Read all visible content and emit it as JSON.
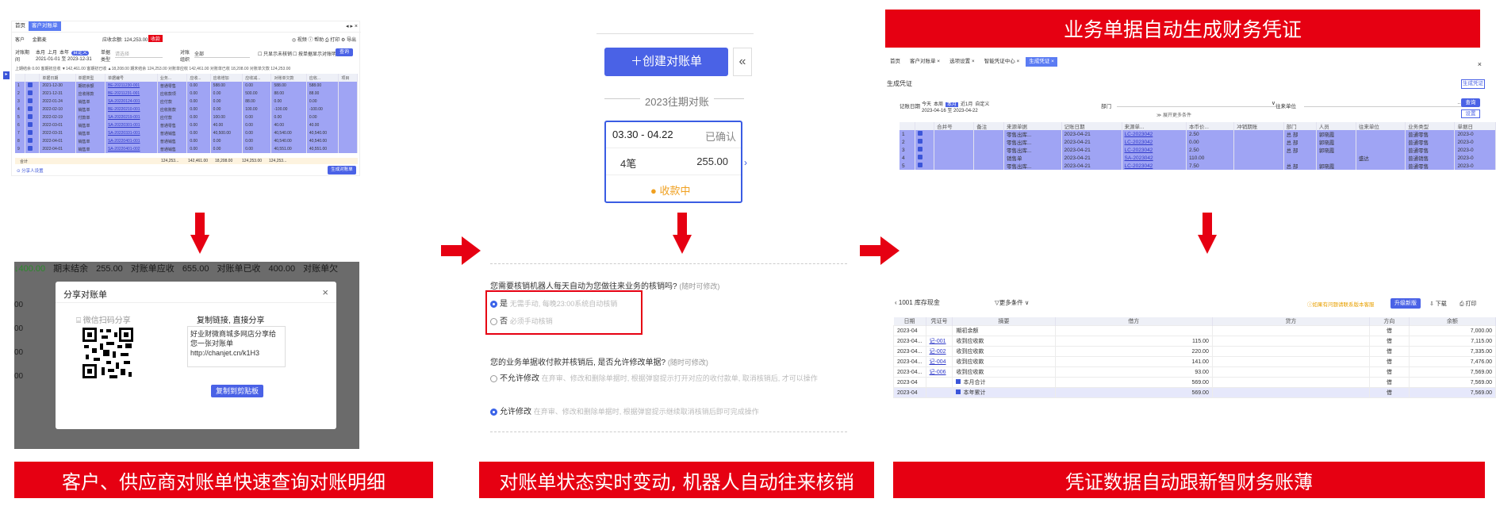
{
  "panel1": {
    "tabs": [
      "首页",
      "客户对账单"
    ],
    "top_right": "◂ ▸ ×",
    "customer_label": "客户",
    "customer_value": "金鹏麦",
    "balance_label": "应收余额: 124,253.00",
    "balance_tag": "收款",
    "actions": "◎ 视频  ⓘ 帮助  ⎙ 打印 ⚙ 导出",
    "period_label": "对账期间",
    "period_opts": [
      "本月",
      "上月",
      "本年",
      "自定义"
    ],
    "period_range": "2021-01-01 至 2023-12-31",
    "doc_type_label": "单据类型",
    "doc_type_value": "请选择",
    "org_label": "对账组织",
    "org_value": "全部",
    "option1": "只显示未核销",
    "option2": "按单据显示对账明细",
    "query_btn": "查询",
    "summary": "上期结余 0.00   客期初应收 ▼142,461.00   客期初已收 ▲18,208.00   期末结余 124,253.00   对账单应收 142,461.00   对账单已收 18,208.00   对账单欠款 124,253.00",
    "columns": [
      "",
      "",
      "单据日期",
      "单据类型",
      "单据编号",
      "业务...",
      "应收...",
      "应收增加",
      "应收减...",
      "对账单欠款",
      "应收...",
      "项目"
    ],
    "rows": [
      [
        "1",
        "2021-12-30",
        "期初余额",
        "BE-20211230-001",
        "普通零售",
        "0.00",
        "588.00",
        "0.00",
        "588.00",
        "588.00"
      ],
      [
        "2",
        "2021-12-31",
        "应收账款",
        "BE-20211231-001",
        "应收款项",
        "0.00",
        "0.00",
        "500.00",
        "88.00",
        "88.00"
      ],
      [
        "3",
        "2022-01-24",
        "销售单",
        "SA-20220124-001",
        "应付款",
        "0.00",
        "0.00",
        "88.00",
        "0.00",
        "0.00"
      ],
      [
        "4",
        "2022-02-10",
        "销售单",
        "BE-20220210-001",
        "应收账款",
        "0.00",
        "0.00",
        "100.00",
        "-100.00",
        "-100.00"
      ],
      [
        "5",
        "2022-02-19",
        "付款单",
        "SA-20220219-001",
        "应付款",
        "0.00",
        "100.00",
        "0.00",
        "0.00",
        "0.00"
      ],
      [
        "6",
        "2022-03-01",
        "销售单",
        "SA-20220301-001",
        "普通零售",
        "0.00",
        "40.00",
        "0.00",
        "40.00",
        "40.00"
      ],
      [
        "7",
        "2022-03-31",
        "销售单",
        "SA-20220331-001",
        "普通销售",
        "0.00",
        "40,500.00",
        "0.00",
        "40,540.00",
        "40,540.00"
      ],
      [
        "8",
        "2022-04-01",
        "销售单",
        "SA-20220401-001",
        "普通销售",
        "0.00",
        "0.00",
        "0.00",
        "40,540.00",
        "40,540.00"
      ],
      [
        "9",
        "2022-04-01",
        "销售单",
        "SA-20220401-002",
        "普通销售",
        "0.00",
        "0.00",
        "0.00",
        "40,551.00",
        "40,551.00"
      ]
    ],
    "total_row": [
      "合计",
      "124,253...",
      "142,461.00",
      "18,208.00",
      "124,253.00",
      "124,253..."
    ],
    "share_people": "⊙ 分享人设置",
    "gen_btn": "生成对账单"
  },
  "panel2": {
    "bg_row": [
      "↓400.00",
      "期末结余",
      "255.00",
      "对账单应收",
      "655.00",
      "对账单已收",
      "400.00",
      "对账单欠"
    ],
    "bg_left": [
      "00",
      "00",
      "00",
      "00"
    ],
    "dialog_title": "分享对账单",
    "close": "×",
    "wechat_label": "⌸ 微信扫码分享",
    "copy_title": "复制链接, 直接分享",
    "share_text": "好业财微商城多网店分享给您一张对账单",
    "share_link": "http://chanjet.cn/k1H3",
    "copy_btn": "复制到剪贴板"
  },
  "panel3": {
    "create_btn": "＋创建对账单",
    "collapse": "«",
    "year_label": "2023往期对账",
    "card_range": "03.30 - 04.22",
    "card_status": "已确认",
    "card_count": "4笔",
    "card_amount": "255.00",
    "card_receive": "收款中",
    "q1": "您需要核销机器人每天自动为您做往来业务的核销吗?",
    "q1_note": "(随时可修改)",
    "q1_opt1": "是",
    "q1_opt1_desc": "无需手动, 每晚23:00系统自动核销",
    "q1_opt2": "否",
    "q1_opt2_desc": "必须手动核销",
    "q2": "您的业务单据收付款并核销后, 是否允许修改单据?",
    "q2_note": "(随时可修改)",
    "q2_opt1": "不允许修改",
    "q2_opt1_desc": "在弃审、修改和删除单据时, 根据弹窗提示打开对应的收付款单, 取消核销后, 才可以操作",
    "q2_opt2": "允许修改",
    "q2_opt2_desc": "在弃审、修改和删除单据时, 根据弹窗提示继续取消核销后即可完成操作"
  },
  "panel4": {
    "tabs": [
      "首页",
      "客户对账单 ×",
      "选项设置 ×",
      "智能凭证中心 ×",
      "生成凭证 ×"
    ],
    "close": "×",
    "title": "生成凭证",
    "gen_btn": "生成凭证",
    "date_label": "记账日期",
    "date_opts": [
      "今天",
      "本周",
      "本月",
      "近1月",
      "自定义"
    ],
    "date_range": "2023-04-16 至 2023-04-22",
    "dept_label": "部门",
    "partner_label": "往来单位",
    "more": "≫ 展开更多条件",
    "query_btn": "查询",
    "settings_btn": "设置",
    "columns": [
      "",
      "",
      "合并号",
      "备注",
      "来源单据",
      "记账日期",
      "来源单...",
      "本币价...",
      "冲销期账",
      "部门",
      "人员",
      "往来单位",
      "业务类型",
      "单据日"
    ],
    "rows": [
      [
        "1",
        "",
        "",
        "零售出库...",
        "2023-04-21",
        "LC-2023042",
        "2.50",
        "",
        "总 部",
        "郭晓霞",
        "",
        "普通零售",
        "2023-0"
      ],
      [
        "2",
        "",
        "",
        "零售出库...",
        "2023-04-21",
        "LC-2023042",
        "0.00",
        "",
        "总 部",
        "郭晓霞",
        "",
        "普通零售",
        "2023-0"
      ],
      [
        "3",
        "",
        "",
        "零售出库...",
        "2023-04-21",
        "LC-2023042",
        "2.50",
        "",
        "总 部",
        "郭晓霞",
        "",
        "普通零售",
        "2023-0"
      ],
      [
        "4",
        "",
        "",
        "销售单",
        "2023-04-21",
        "SA-2023042",
        "110.00",
        "",
        "",
        "",
        "盛达",
        "普通销售",
        "2023-0"
      ],
      [
        "5",
        "",
        "",
        "零售出库...",
        "2023-04-21",
        "LC-2023042",
        "7.50",
        "",
        "总 部",
        "郭晓霞",
        "",
        "普通零售",
        "2023-0"
      ]
    ]
  },
  "panel5": {
    "account": "1001 库存现金",
    "more_filter": "▽更多条件 ∨",
    "notice": "ⓘ如果有问题请联系版本客服",
    "upgrade_btn": "升级新版",
    "download": "⇩ 下载",
    "print": "⎙ 打印",
    "columns": [
      "日期",
      "凭证号",
      "摘要",
      "借方",
      "贷方",
      "方向",
      "余额"
    ],
    "rows": [
      [
        "2023-04",
        "",
        "期初余额",
        "",
        "",
        "借",
        "7,000.00"
      ],
      [
        "2023-04...",
        "记-001",
        "收到应收款",
        "115.00",
        "",
        "借",
        "7,115.00"
      ],
      [
        "2023-04...",
        "记-002",
        "收到应收款",
        "220.00",
        "",
        "借",
        "7,335.00"
      ],
      [
        "2023-04...",
        "记-004",
        "收到应收款",
        "141.00",
        "",
        "借",
        "7,476.00"
      ],
      [
        "2023-04...",
        "记-006",
        "收到应收款",
        "93.00",
        "",
        "借",
        "7,569.00"
      ],
      [
        "2023-04",
        "",
        "本月合计",
        "569.00",
        "",
        "借",
        "7,569.00"
      ],
      [
        "2023-04",
        "",
        "本年累计",
        "569.00",
        "",
        "借",
        "7,569.00"
      ]
    ]
  },
  "banners": {
    "top": "业务单据自动生成财务凭证",
    "bottom1": "客户、供应商对账单快速查询对账明细",
    "bottom2": "对账单状态实时变动, 机器人自动往来核销",
    "bottom3": "凭证数据自动跟新智财务账薄"
  },
  "colors": {
    "red": "#e60012",
    "blue": "#4a62e6",
    "row_highlight": "#9fa4f4"
  }
}
